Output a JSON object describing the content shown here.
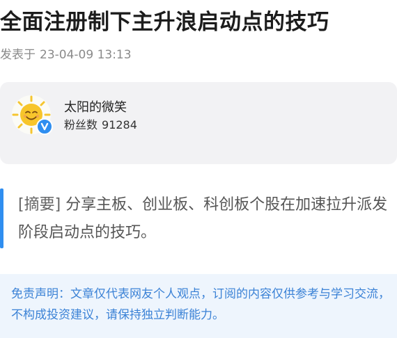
{
  "article": {
    "title": "全面注册制下主升浪启动点的技巧",
    "published_prefix": "发表于",
    "published_time": "23-04-09 13:13"
  },
  "author": {
    "name": "太阳的微笑",
    "fans_label": "粉丝数",
    "fans_count": "91284",
    "avatar_icon": "smiling-sun-icon",
    "verified_icon": "verified-v-icon"
  },
  "summary": {
    "tag": "[摘要]",
    "text": "分享主板、创业板、科创板个股在加速拉升派发阶段启动点的技巧。"
  },
  "disclaimer": {
    "text": "免责声明：文章仅代表网友个人观点，订阅的内容仅供参考与学习交流，不构成投资建议，请保持独立判断能力。"
  },
  "colors": {
    "accent": "#2f8ef0",
    "disclaimer_bg": "#eef5fd",
    "disclaimer_text": "#3b82d6",
    "card_bg": "#f2f2f4"
  }
}
